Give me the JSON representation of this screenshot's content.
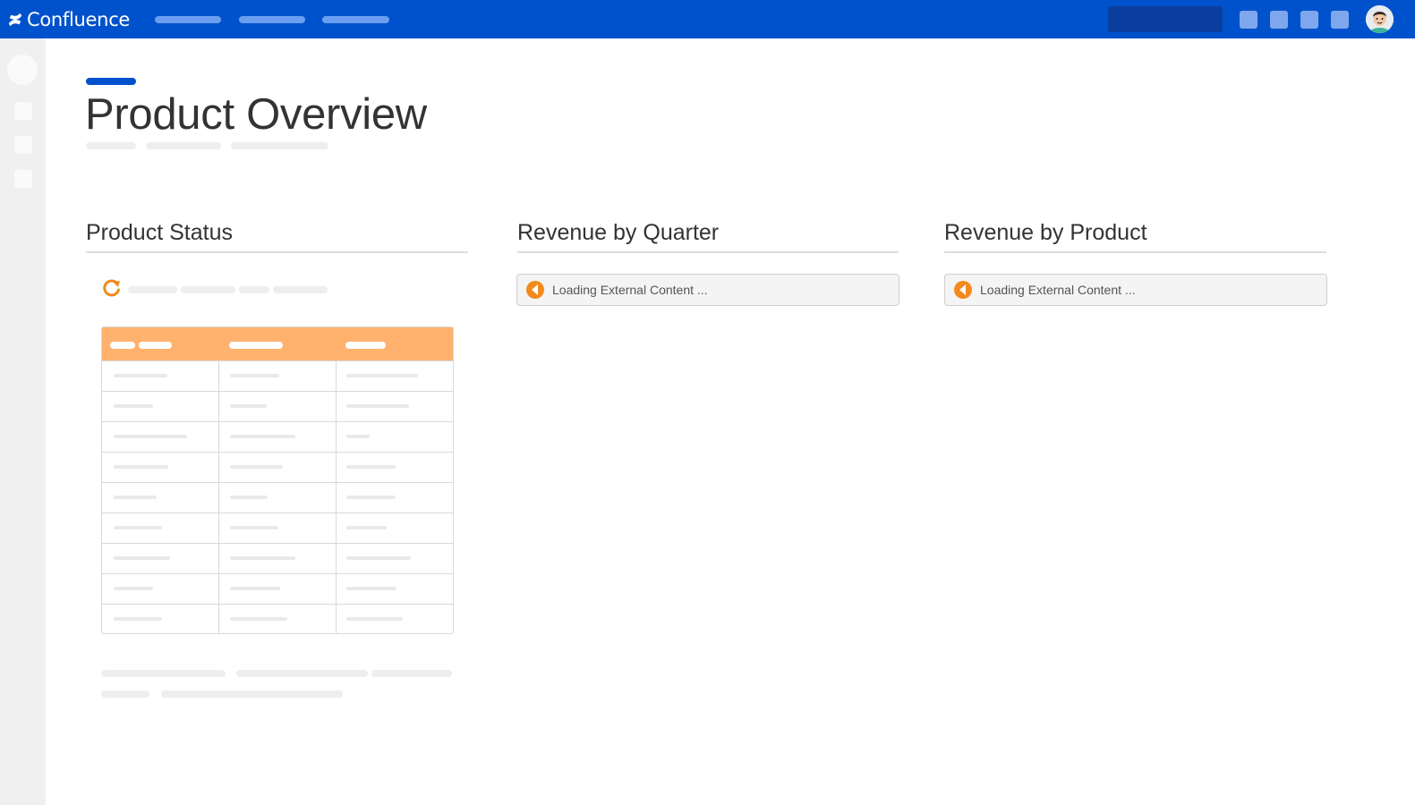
{
  "header": {
    "app_name": "Confluence",
    "brand_color": "#0052cc",
    "icons": [
      "confluence-logo-icon",
      "avatar"
    ]
  },
  "page": {
    "title": "Product Overview",
    "accent_color": "#0052cc"
  },
  "sections": {
    "product_status": {
      "title": "Product Status",
      "icon": "refresh-icon",
      "table_header_color": "#ffb26e"
    },
    "revenue_by_quarter": {
      "title": "Revenue by Quarter",
      "loading_text": "Loading External Content ...",
      "icon": "external-content-icon"
    },
    "revenue_by_product": {
      "title": "Revenue by Product",
      "loading_text": "Loading External Content ...",
      "icon": "external-content-icon"
    }
  }
}
